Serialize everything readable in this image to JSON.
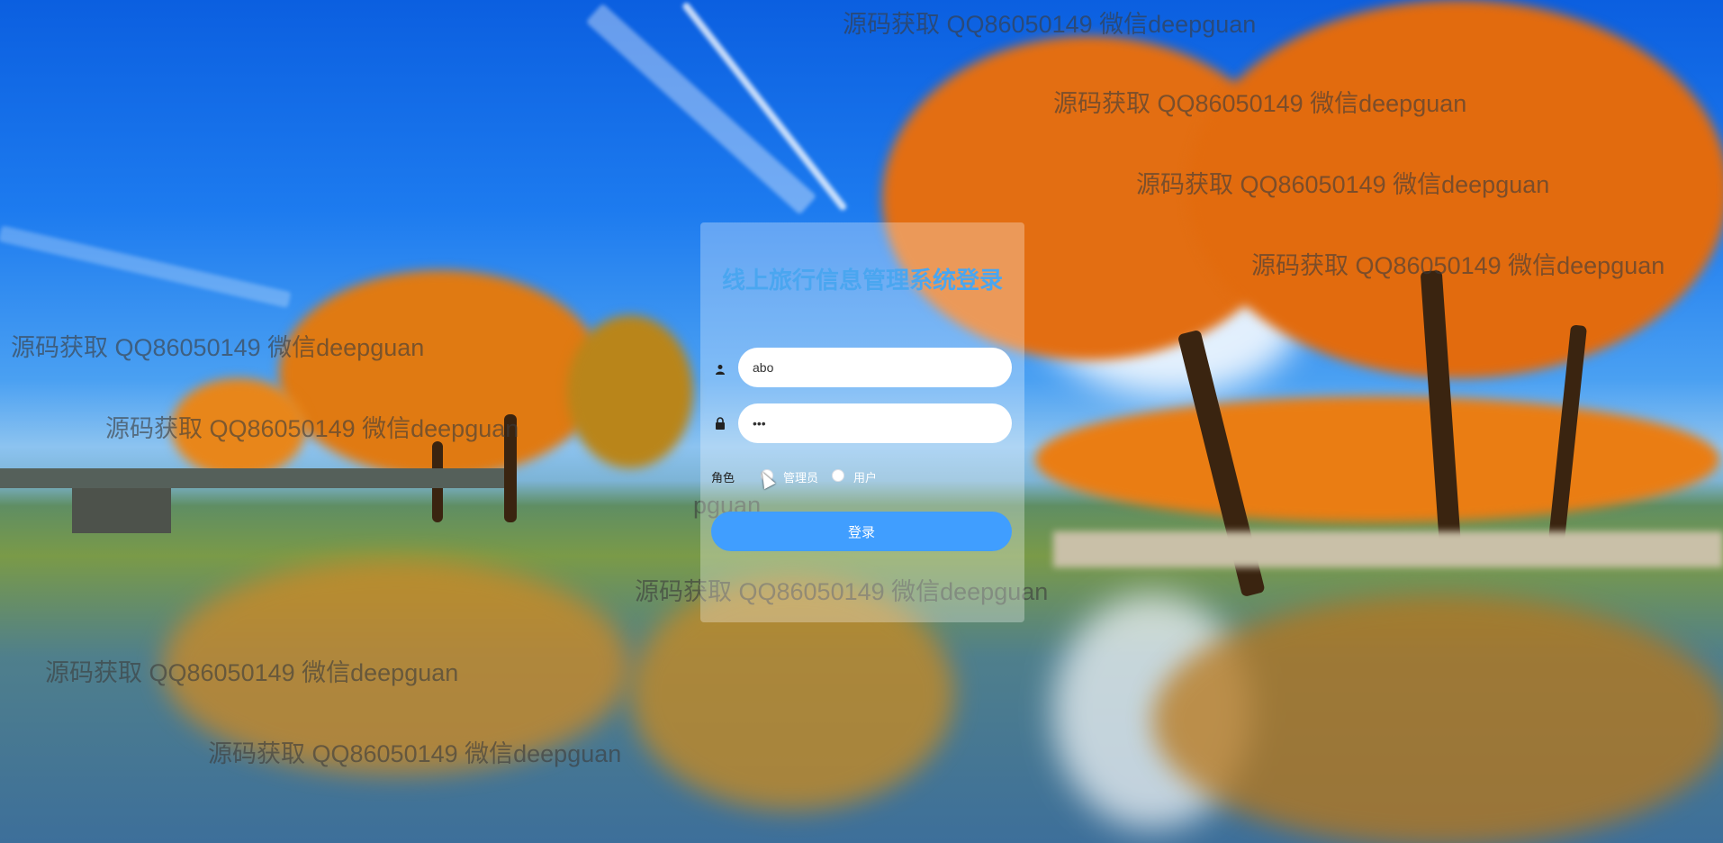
{
  "login": {
    "title": "线上旅行信息管理系统登录",
    "username_value": "abo",
    "username_icon": "user-icon",
    "password_value": "•••",
    "password_icon": "lock-icon",
    "role_label": "角色",
    "roles": [
      "管理员",
      "用户"
    ],
    "submit_label": "登录"
  },
  "watermark": {
    "text": "源码获取 QQ86050149 微信deepguan",
    "partial_text": "pguan"
  },
  "colors": {
    "accent": "#409eff",
    "title": "#4aa6f0"
  }
}
